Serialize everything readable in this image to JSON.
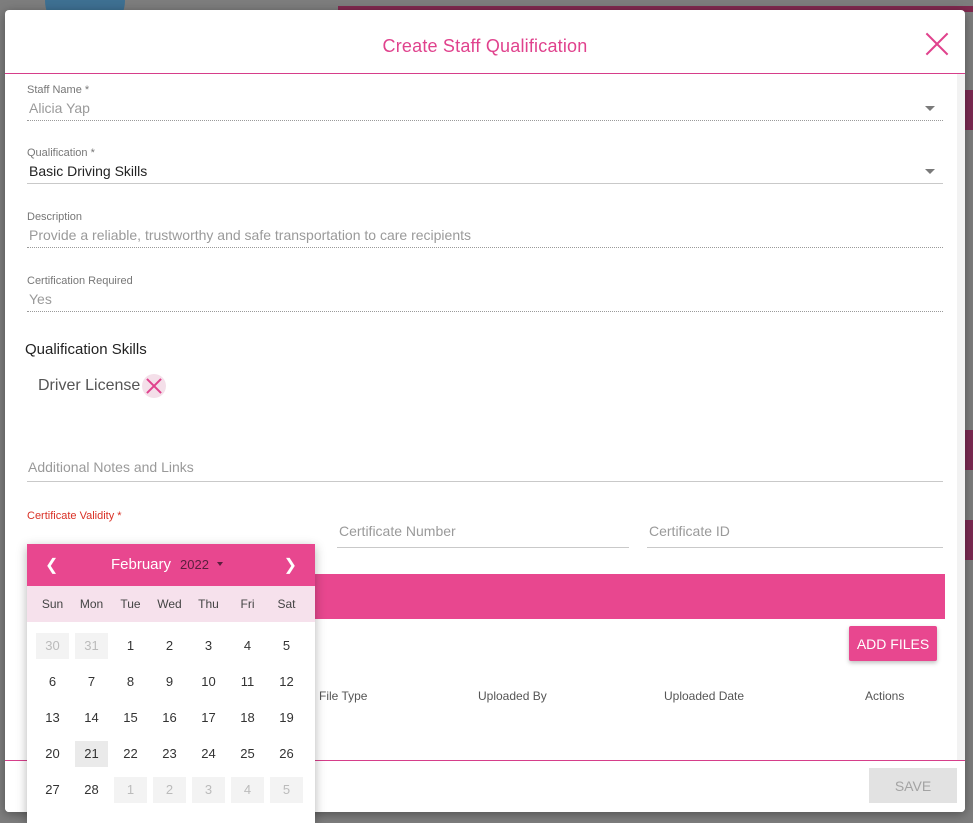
{
  "modal": {
    "title": "Create Staff Qualification",
    "close_icon": "close-icon"
  },
  "form": {
    "staff_name": {
      "label": "Staff Name *",
      "value": "Alicia Yap"
    },
    "qualification": {
      "label": "Qualification *",
      "value": "Basic Driving Skills"
    },
    "description": {
      "label": "Description",
      "value": "Provide a reliable, trustworthy and safe transportation to care recipients"
    },
    "certification_required": {
      "label": "Certification Required",
      "value": "Yes"
    },
    "skills_title": "Qualification Skills",
    "skills": [
      {
        "label": "Driver License"
      }
    ],
    "notes_placeholder": "Additional Notes and Links",
    "certificate_validity_label": "Certificate Validity *",
    "certificate_number_placeholder": "Certificate Number",
    "certificate_id_placeholder": "Certificate ID"
  },
  "files": {
    "add_files_label": "ADD FILES",
    "columns": [
      "File Type",
      "Uploaded By",
      "Uploaded Date",
      "Actions"
    ]
  },
  "footer": {
    "save_label": "SAVE"
  },
  "datepicker": {
    "prev": "❮",
    "next": "❯",
    "month": "February",
    "year": "2022",
    "weekdays": [
      "Sun",
      "Mon",
      "Tue",
      "Wed",
      "Thu",
      "Fri",
      "Sat"
    ],
    "weeks": [
      [
        {
          "d": "30",
          "muted": true
        },
        {
          "d": "31",
          "muted": true
        },
        {
          "d": "1"
        },
        {
          "d": "2"
        },
        {
          "d": "3"
        },
        {
          "d": "4"
        },
        {
          "d": "5"
        }
      ],
      [
        {
          "d": "6"
        },
        {
          "d": "7"
        },
        {
          "d": "8"
        },
        {
          "d": "9"
        },
        {
          "d": "10"
        },
        {
          "d": "11"
        },
        {
          "d": "12"
        }
      ],
      [
        {
          "d": "13"
        },
        {
          "d": "14"
        },
        {
          "d": "15"
        },
        {
          "d": "16"
        },
        {
          "d": "17"
        },
        {
          "d": "18"
        },
        {
          "d": "19"
        }
      ],
      [
        {
          "d": "20"
        },
        {
          "d": "21",
          "today": true
        },
        {
          "d": "22"
        },
        {
          "d": "23"
        },
        {
          "d": "24"
        },
        {
          "d": "25"
        },
        {
          "d": "26"
        }
      ],
      [
        {
          "d": "27"
        },
        {
          "d": "28"
        },
        {
          "d": "1",
          "muted": true
        },
        {
          "d": "2",
          "muted": true
        },
        {
          "d": "3",
          "muted": true
        },
        {
          "d": "4",
          "muted": true
        },
        {
          "d": "5",
          "muted": true
        }
      ]
    ]
  },
  "colors": {
    "accent": "#e8478f",
    "header_text": "#e0428d",
    "validity_label": "#d93025"
  }
}
